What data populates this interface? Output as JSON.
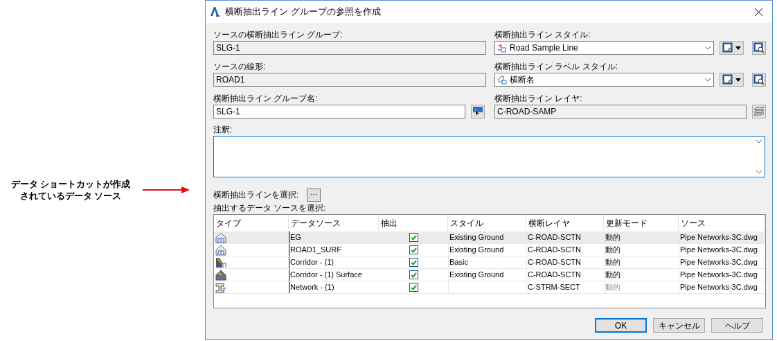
{
  "annotation": {
    "text": "データ ショートカットが作成されているデータ ソース"
  },
  "window": {
    "title": "横断抽出ライン グループの参照を作成"
  },
  "source_group": {
    "label": "ソースの横断抽出ライン グループ:",
    "value": "SLG-1"
  },
  "source_alignment": {
    "label": "ソースの線形:",
    "value": "ROAD1"
  },
  "group_name": {
    "label": "横断抽出ライン グループ名:",
    "value": "SLG-1"
  },
  "line_style": {
    "label": "横断抽出ライン スタイル:",
    "value": "Road Sample Line"
  },
  "label_style": {
    "label": "横断抽出ライン ラベル スタイル:",
    "value": "横断名"
  },
  "layer": {
    "label": "横断抽出ライン レイヤ:",
    "value": "C-ROAD-SAMP"
  },
  "notes": {
    "label": "注釈:"
  },
  "select_lines": {
    "label": "横断抽出ラインを選択:",
    "button": "···"
  },
  "select_sources": {
    "label": "抽出するデータ ソースを選択:"
  },
  "table": {
    "columns": [
      "タイプ",
      "データソース",
      "抽出",
      "スタイル",
      "横断レイヤ",
      "更新モード",
      "ソース"
    ],
    "rows": [
      {
        "kind": "surface",
        "selected": true,
        "name": "EG",
        "checked": true,
        "style": "Existing Ground",
        "layer": "C-ROAD-SCTN",
        "mode": "動的",
        "mode_disabled": false,
        "source": "Pipe Networks-3C.dwg"
      },
      {
        "kind": "surface",
        "selected": false,
        "name": "ROAD1_SURF",
        "checked": true,
        "style": "Existing Ground",
        "layer": "C-ROAD-SCTN",
        "mode": "動的",
        "mode_disabled": false,
        "source": "Pipe Networks-3C.dwg"
      },
      {
        "kind": "corridor",
        "selected": false,
        "name": "Corridor - (1)",
        "checked": true,
        "style": "Basic",
        "layer": "C-ROAD-SCTN",
        "mode": "動的",
        "mode_disabled": false,
        "source": "Pipe Networks-3C.dwg"
      },
      {
        "kind": "corridor_surface",
        "selected": false,
        "name": "Corridor - (1) Surface",
        "checked": true,
        "style": "Existing Ground",
        "layer": "C-ROAD-SCTN",
        "mode": "動的",
        "mode_disabled": false,
        "source": "Pipe Networks-3C.dwg"
      },
      {
        "kind": "network",
        "selected": false,
        "name": "Network - (1)",
        "checked": true,
        "layer": "C-STRM-SECT",
        "mode": "動的",
        "mode_disabled": true,
        "source": "Pipe Networks-3C.dwg"
      }
    ]
  },
  "buttons": [
    {
      "label": "OK",
      "default": true
    },
    {
      "label": "キャンセル",
      "default": false
    },
    {
      "label": "ヘルプ",
      "default": false
    }
  ]
}
